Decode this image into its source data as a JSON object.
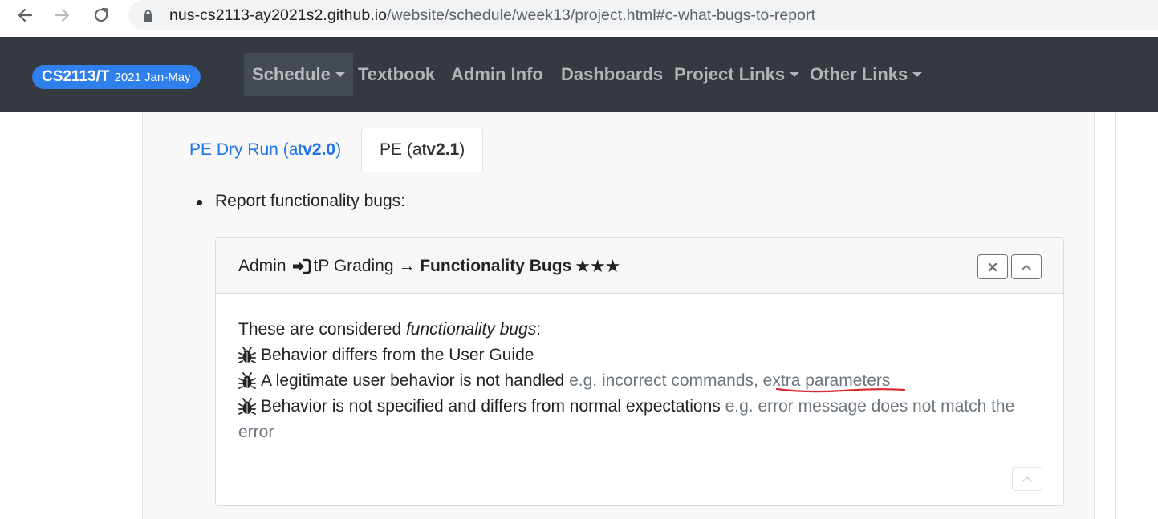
{
  "browser": {
    "url_host": "nus-cs2113-ay2021s2.github.io",
    "url_path": "/website/schedule/week13/project.html#c-what-bugs-to-report",
    "back_icon": "arrow-left-icon",
    "forward_icon": "arrow-right-icon",
    "reload_icon": "reload-icon",
    "lock_icon": "lock-icon"
  },
  "navbar": {
    "brand_main": "CS2113/T",
    "brand_sub": "2021 Jan-May",
    "brand_color": "#2f80ed",
    "background": "#343a40",
    "items": [
      {
        "label": "Schedule",
        "dropdown": true,
        "active": true
      },
      {
        "label": "Textbook",
        "dropdown": false
      },
      {
        "label": "Admin Info",
        "dropdown": false
      },
      {
        "label": "Dashboards",
        "dropdown": false
      },
      {
        "label": "Project Links",
        "dropdown": true
      },
      {
        "label": "Other Links",
        "dropdown": true
      }
    ]
  },
  "tabs": [
    {
      "prefix": "PE Dry Run (at ",
      "version": "v2.0",
      "suffix": ")",
      "active": false
    },
    {
      "prefix": "PE (at ",
      "version": "v2.1",
      "suffix": ")",
      "active": true
    }
  ],
  "bullet": "Report functionality bugs:",
  "card": {
    "title_prefix": "Admin",
    "title_icon": "login-icon",
    "title_middle": "tP Grading →",
    "title_strong": "Functionality Bugs",
    "title_stars": "★★★",
    "close_icon": "close-icon",
    "collapse_icon": "chevron-up-icon",
    "intro_prefix": "These are considered ",
    "intro_em": "functionality bugs",
    "intro_suffix": ":",
    "bug_icon": "bug-icon",
    "items": [
      {
        "text": "Behavior differs from the User Guide",
        "muted": ""
      },
      {
        "text": "A legitimate user behavior is not handled",
        "muted": "e.g. incorrect commands, extra parameters"
      },
      {
        "text": "Behavior is not specified and differs from normal expectations",
        "muted": "e.g. error message does not match the"
      }
    ],
    "wrap_text": "error",
    "footer_icon": "chevron-up-icon"
  },
  "annotation_color": "#d9272e"
}
